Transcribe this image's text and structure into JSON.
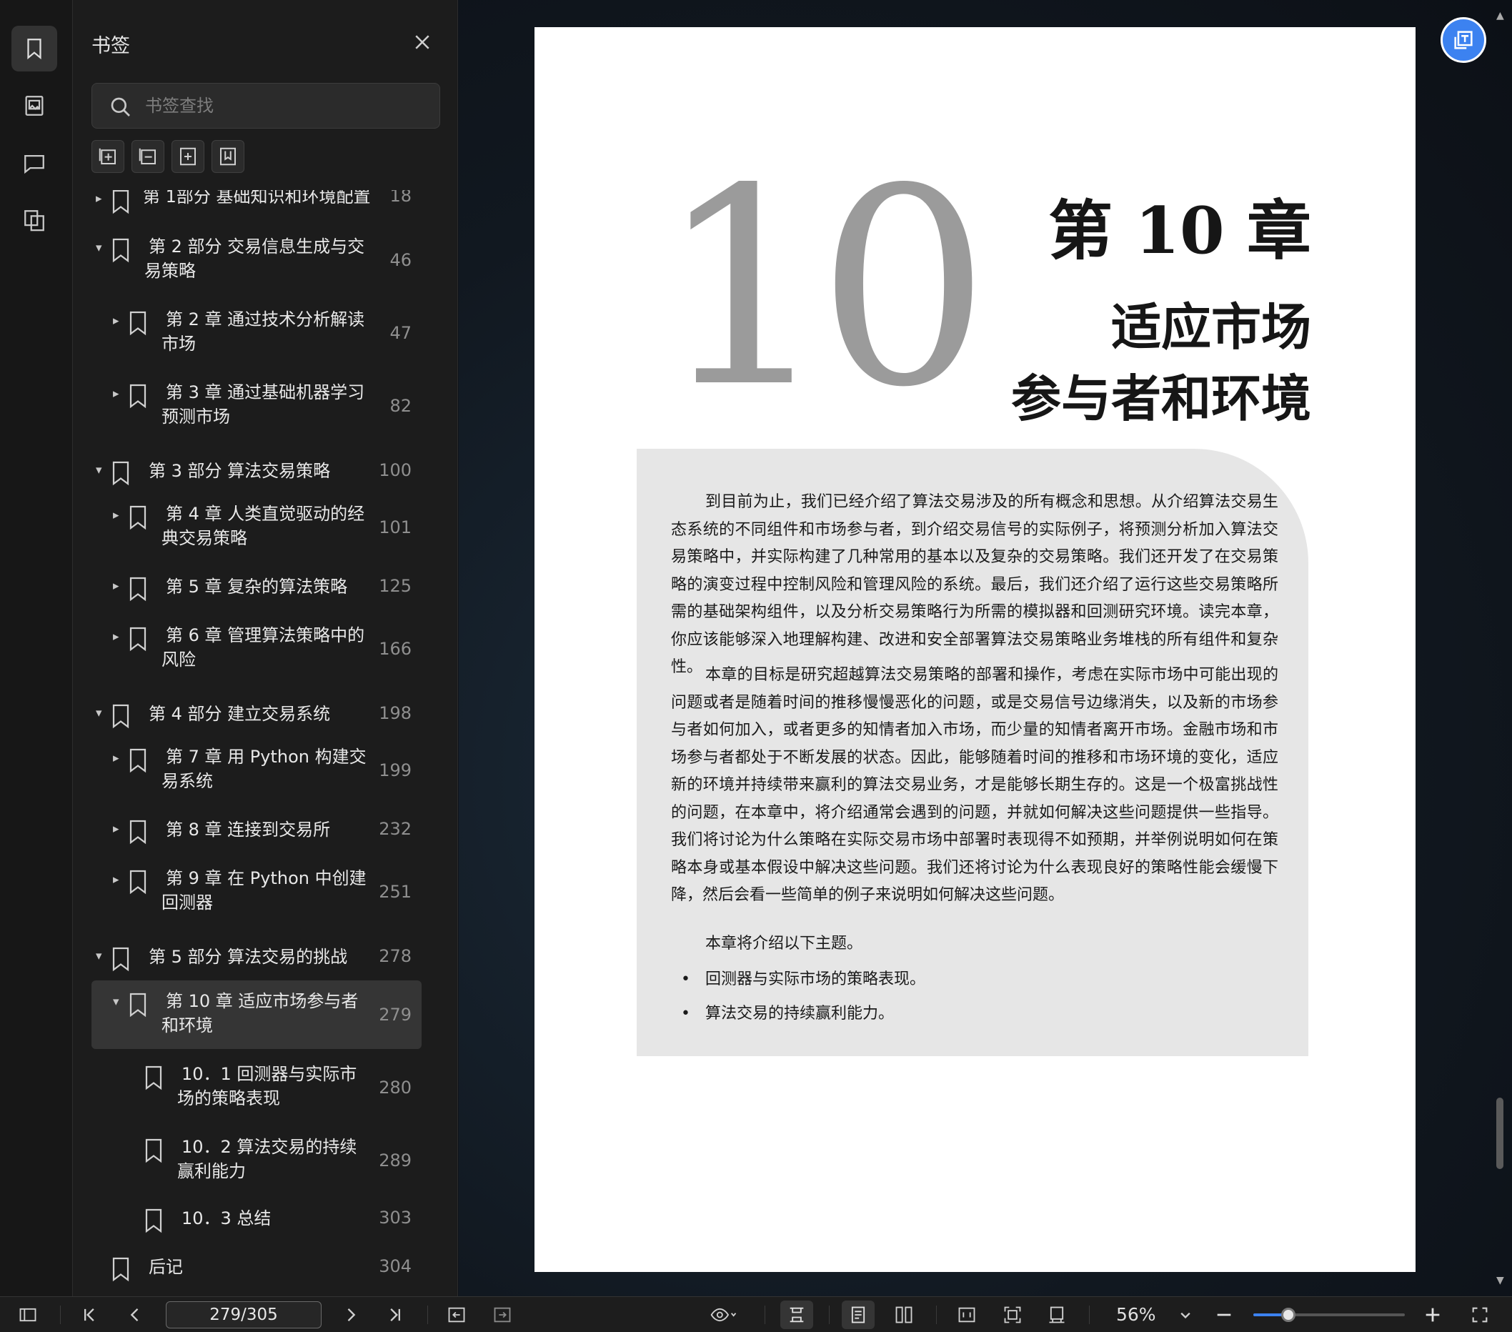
{
  "panel": {
    "title": "书签",
    "search_placeholder": "书签查找"
  },
  "bookmarks": [
    {
      "label": "第 1部分 基础知识和环境配置",
      "page": "18",
      "level": 0,
      "state": "collapsed"
    },
    {
      "label": "第 2 部分 交易信息生成与交易策略",
      "page": "46",
      "level": 0,
      "state": "expanded"
    },
    {
      "label": "第 2 章 通过技术分析解读市场",
      "page": "47",
      "level": 1,
      "state": "collapsed"
    },
    {
      "label": "第 3 章 通过基础机器学习预测市场",
      "page": "82",
      "level": 1,
      "state": "collapsed"
    },
    {
      "label": "第 3 部分 算法交易策略",
      "page": "100",
      "level": 0,
      "state": "expanded"
    },
    {
      "label": "第 4 章 人类直觉驱动的经典交易策略",
      "page": "101",
      "level": 1,
      "state": "collapsed"
    },
    {
      "label": "第 5 章 复杂的算法策略",
      "page": "125",
      "level": 1,
      "state": "collapsed"
    },
    {
      "label": "第 6 章 管理算法策略中的风险",
      "page": "166",
      "level": 1,
      "state": "collapsed"
    },
    {
      "label": "第 4 部分 建立交易系统",
      "page": "198",
      "level": 0,
      "state": "expanded"
    },
    {
      "label": "第 7 章 用 Python 构建交易系统",
      "page": "199",
      "level": 1,
      "state": "collapsed"
    },
    {
      "label": "第 8 章 连接到交易所",
      "page": "232",
      "level": 1,
      "state": "collapsed"
    },
    {
      "label": "第 9 章 在 Python 中创建回测器",
      "page": "251",
      "level": 1,
      "state": "collapsed"
    },
    {
      "label": "第 5 部分 算法交易的挑战",
      "page": "278",
      "level": 0,
      "state": "expanded"
    },
    {
      "label": "第 10 章 适应市场参与者和环境",
      "page": "279",
      "level": 1,
      "state": "expanded",
      "selected": true
    },
    {
      "label": "10．1 回测器与实际市场的策略表现",
      "page": "280",
      "level": 2,
      "state": "leaf"
    },
    {
      "label": "10．2 算法交易的持续赢利能力",
      "page": "289",
      "level": 2,
      "state": "leaf"
    },
    {
      "label": "10．3 总结",
      "page": "303",
      "level": 2,
      "state": "leaf"
    },
    {
      "label": "后记",
      "page": "304",
      "level": 0,
      "state": "leaf"
    }
  ],
  "document": {
    "big_number": "10",
    "chapter_no": "第 10 章",
    "chapter_title_1": "适应市场",
    "chapter_title_2": "参与者和环境",
    "para1": "到目前为止，我们已经介绍了算法交易涉及的所有概念和思想。从介绍算法交易生态系统的不同组件和市场参与者，到介绍交易信号的实际例子，将预测分析加入算法交易策略中，并实际构建了几种常用的基本以及复杂的交易策略。我们还开发了在交易策略的演变过程中控制风险和管理风险的系统。最后，我们还介绍了运行这些交易策略所需的基础架构组件，以及分析交易策略行为所需的模拟器和回测研究环境。读完本章，你应该能够深入地理解构建、改进和安全部署算法交易策略业务堆栈的所有组件和复杂性。",
    "para2": "本章的目标是研究超越算法交易策略的部署和操作，考虑在实际市场中可能出现的问题或者是随着时间的推移慢慢恶化的问题，或是交易信号边缘消失，以及新的市场参与者如何加入，或者更多的知情者加入市场，而少量的知情者离开市场。金融市场和市场参与者都处于不断发展的状态。因此，能够随着时间的推移和市场环境的变化，适应新的环境并持续带来赢利的算法交易业务，才是能够长期生存的。这是一个极富挑战性的问题，在本章中，将介绍通常会遇到的问题，并就如何解决这些问题提供一些指导。我们将讨论为什么策略在实际交易市场中部署时表现得不如预期，并举例说明如何在策略本身或基本假设中解决这些问题。我们还将讨论为什么表现良好的策略性能会缓慢下降，然后会看一些简单的例子来说明如何解决这些问题。",
    "para3": "本章将介绍以下主题。",
    "bullet1": "回测器与实际市场的策略表现。",
    "bullet2": "算法交易的持续赢利能力。"
  },
  "toolbar": {
    "page_indicator": "279/305",
    "zoom": "56%",
    "zoom_fraction": 0.56
  },
  "colors": {
    "accent": "#3c82f0",
    "panel_bg": "#1c1c1c",
    "selected_row": "#353535"
  }
}
